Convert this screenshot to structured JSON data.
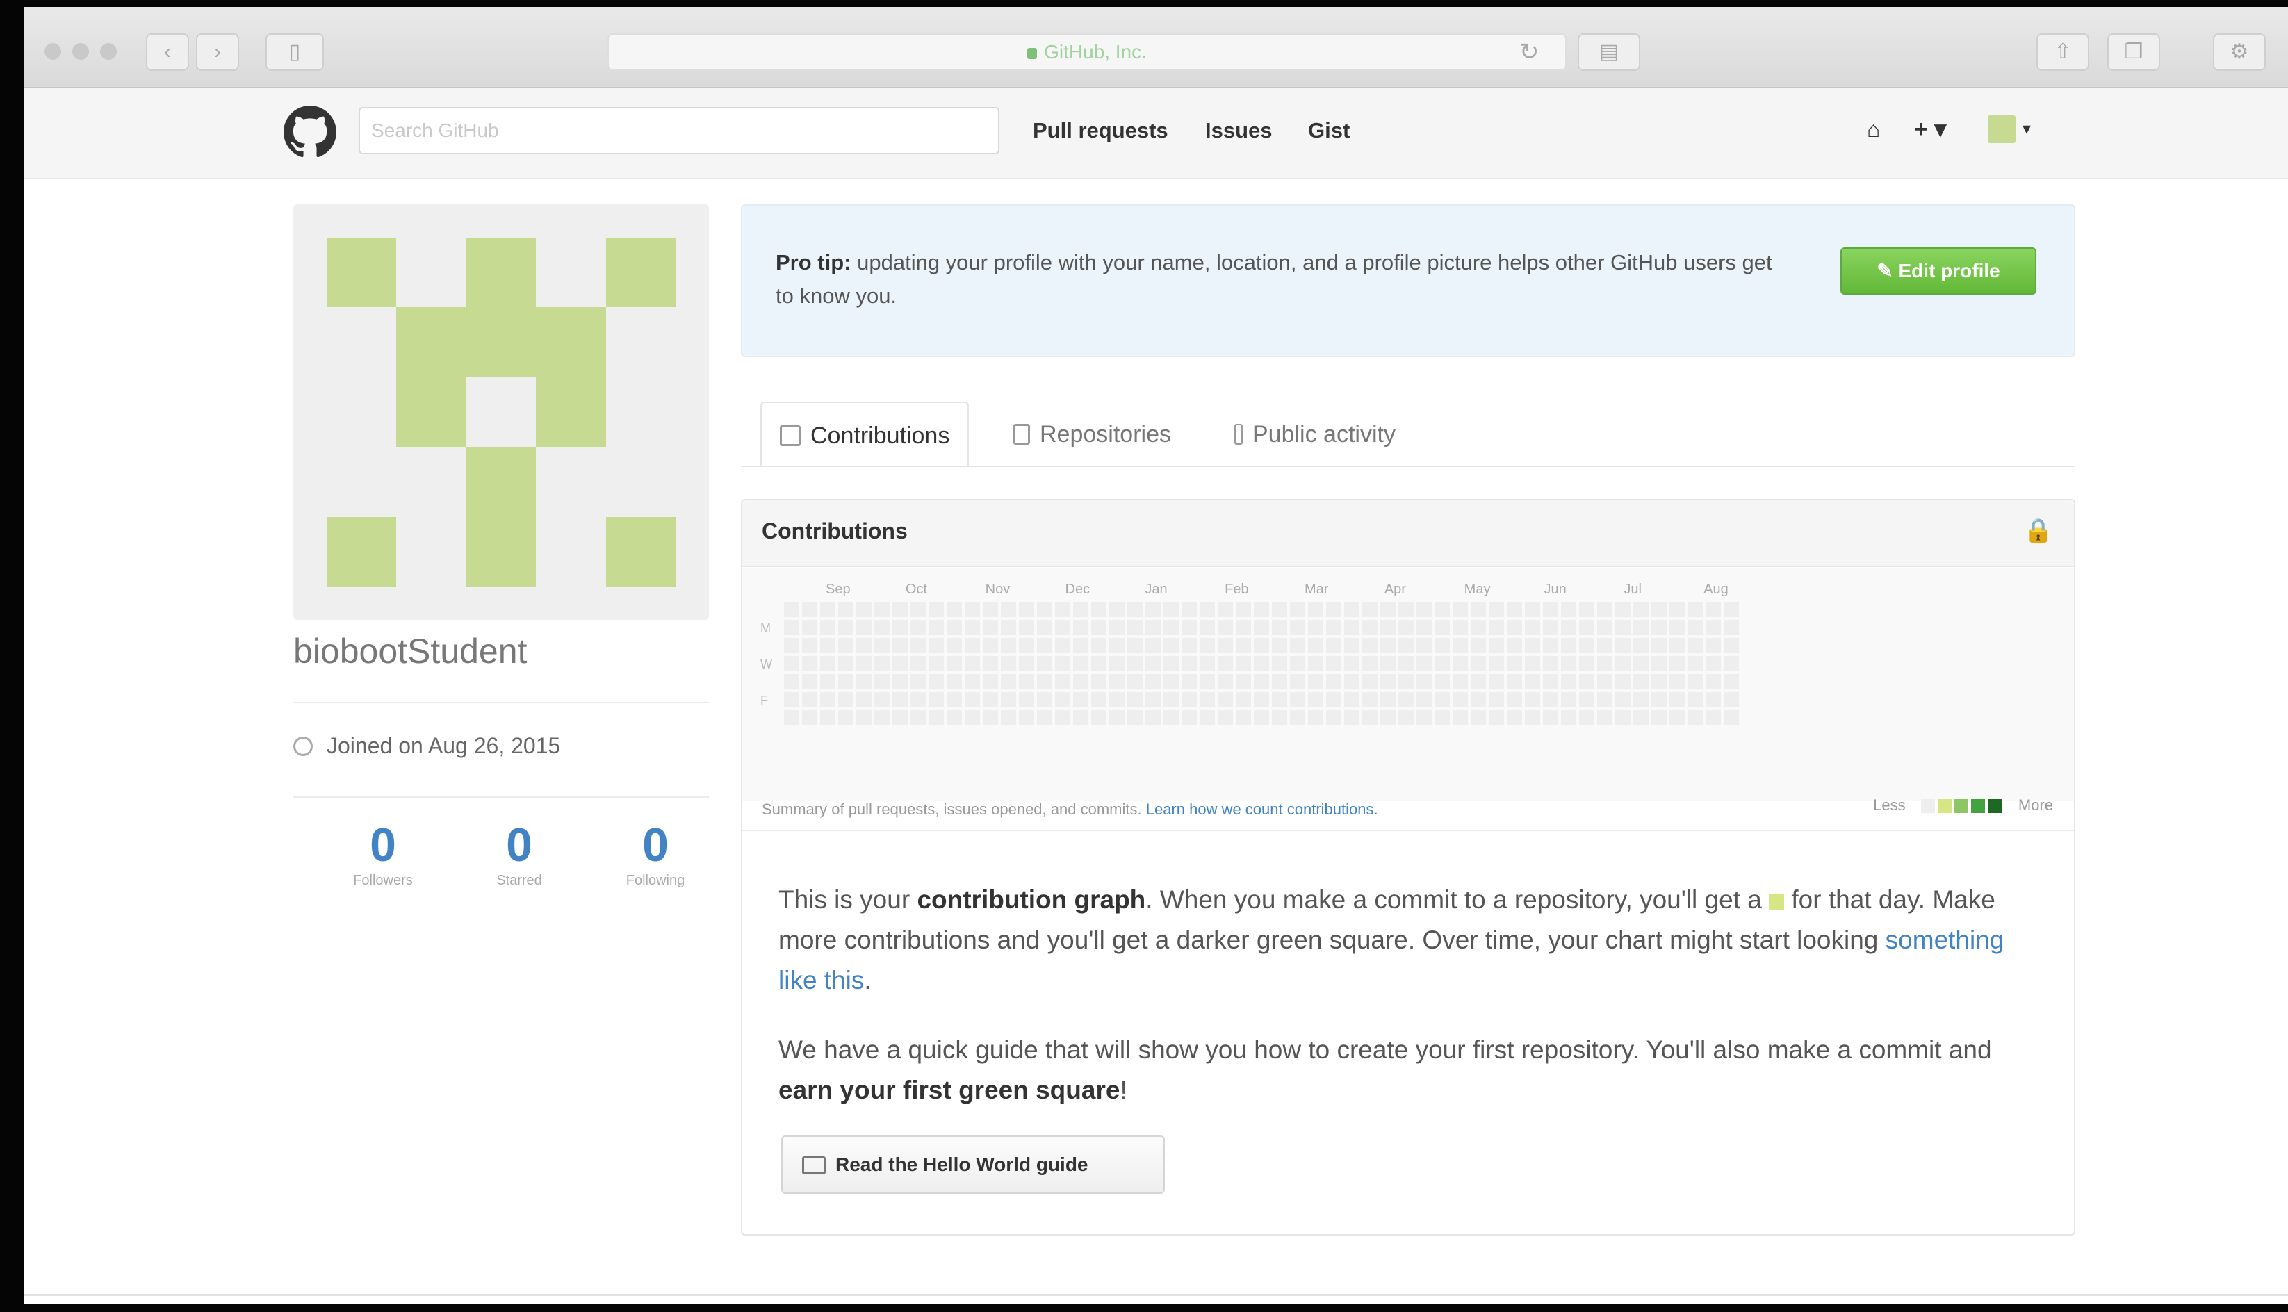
{
  "browser": {
    "url": "GitHub, Inc."
  },
  "header": {
    "search_placeholder": "Search GitHub",
    "nav": [
      "Pull requests",
      "Issues",
      "Gist"
    ],
    "plus_label": "+ ▾",
    "avatar_caret": "▾"
  },
  "profile": {
    "username": "biobootStudent",
    "joined": "Joined on Aug 26, 2015",
    "stats": [
      {
        "value": "0",
        "label": "Followers"
      },
      {
        "value": "0",
        "label": "Starred"
      },
      {
        "value": "0",
        "label": "Following"
      }
    ]
  },
  "protip": {
    "lead": "Pro tip:",
    "text": " updating your profile with your name, location, and a profile picture helps other GitHub users get to know you.",
    "button": "✎ Edit profile"
  },
  "tabs": [
    "Contributions",
    "Repositories",
    "Public activity"
  ],
  "contributions": {
    "title": "Contributions",
    "months": [
      "Sep",
      "Oct",
      "Nov",
      "Dec",
      "Jan",
      "Feb",
      "Mar",
      "Apr",
      "May",
      "Jun",
      "Jul",
      "Aug"
    ],
    "day_labels": [
      "M",
      "W",
      "F"
    ],
    "summary": "Summary of pull requests, issues opened, and commits.",
    "summary_link": "Learn how we count contributions.",
    "legend_less": "Less",
    "legend_more": "More",
    "legend_colors": [
      "#eeeeee",
      "#d6e685",
      "#8cc665",
      "#44a340",
      "#1e6823"
    ]
  },
  "blank_slate": {
    "p1_a": "This is your ",
    "p1_b": "contribution graph",
    "p1_c": ". When you make a commit to a repository, you'll get a ",
    "p1_d": " for that day. Make more contributions and you'll get a darker green square. Over time, your chart might start looking ",
    "p1_link": "something like this",
    "p1_e": ".",
    "p2_a": "We have a quick guide that will show you how to create your first repository. You'll also make a commit and ",
    "p2_b": "earn your first green square",
    "p2_c": "!",
    "button": "Read the Hello World guide"
  }
}
